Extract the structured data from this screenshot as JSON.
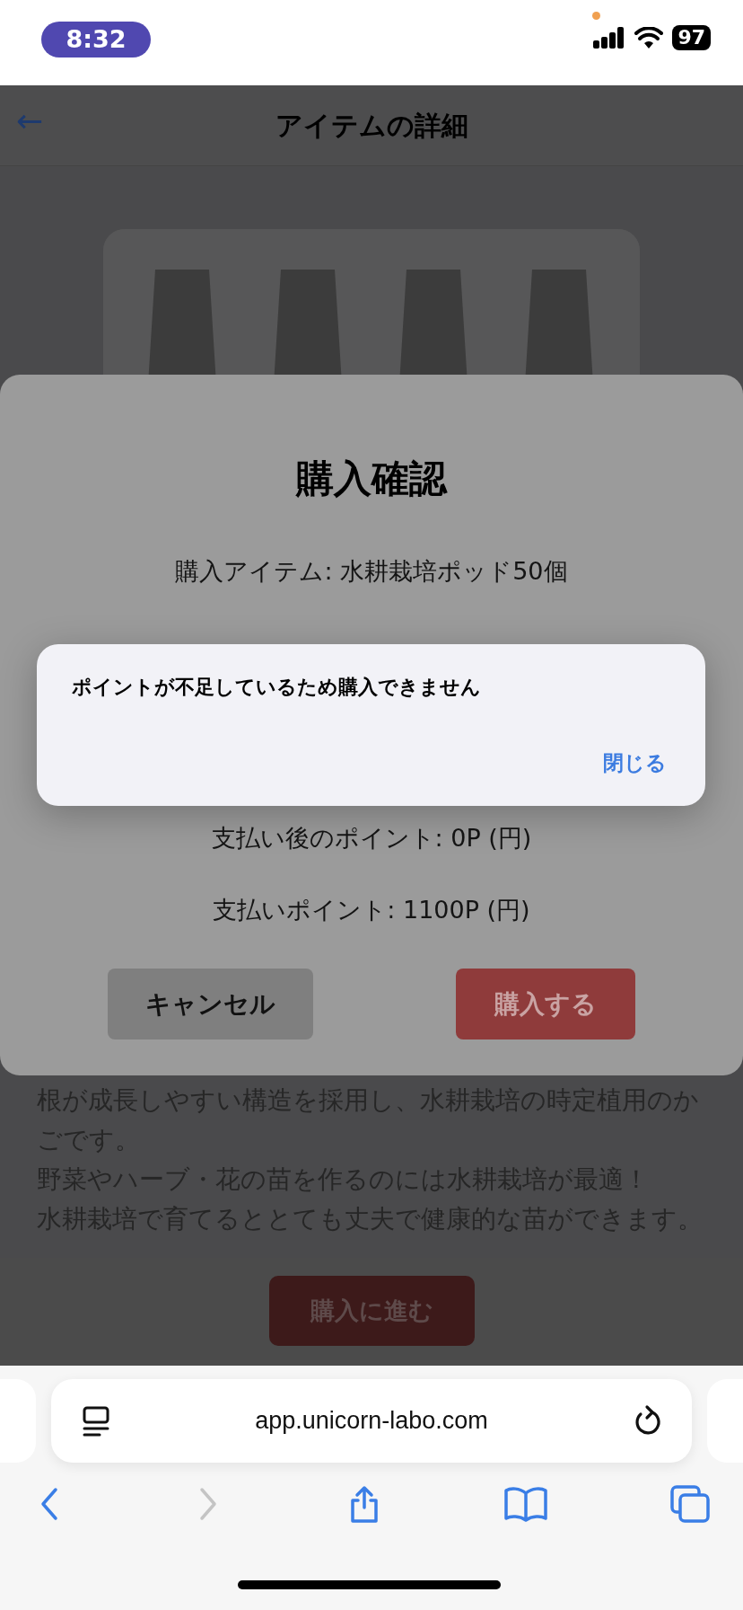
{
  "status_bar": {
    "time": "8:32",
    "battery": "97"
  },
  "header": {
    "back": "←",
    "title": "アイテムの詳細"
  },
  "product": {
    "kind": "picture"
  },
  "description": [
    "根が成長しやすい構造を採用し、水耕栽培の時定植用のか",
    "ごです。",
    "野菜やハーブ・花の苗を作るのには水耕栽培が最適！",
    "水耕栽培で育てるととても丈夫で健康的な苗ができます。"
  ],
  "footer_button": "購入に進む",
  "purchase_sheet": {
    "title": "購入確認",
    "lines": [
      "購入アイテム: 水耕栽培ポッド50個",
      "支払い後のポイント: 0P (円)",
      "支払いポイント: 1100P (円)"
    ],
    "buttons": [
      {
        "label": "キャンセル",
        "kind": "cancel"
      },
      {
        "label": "購入する",
        "kind": "primary"
      }
    ]
  },
  "alert": {
    "message": "ポイントが不足しているため購入できません",
    "button": "閉じる"
  },
  "browser": {
    "url": "app.unicorn-labo.com",
    "nav": [
      {
        "kind": "back",
        "disabled": false
      },
      {
        "kind": "forward",
        "disabled": true
      },
      {
        "kind": "share",
        "disabled": false
      },
      {
        "kind": "bookmarks",
        "disabled": false
      },
      {
        "kind": "tabs",
        "disabled": false
      }
    ]
  }
}
